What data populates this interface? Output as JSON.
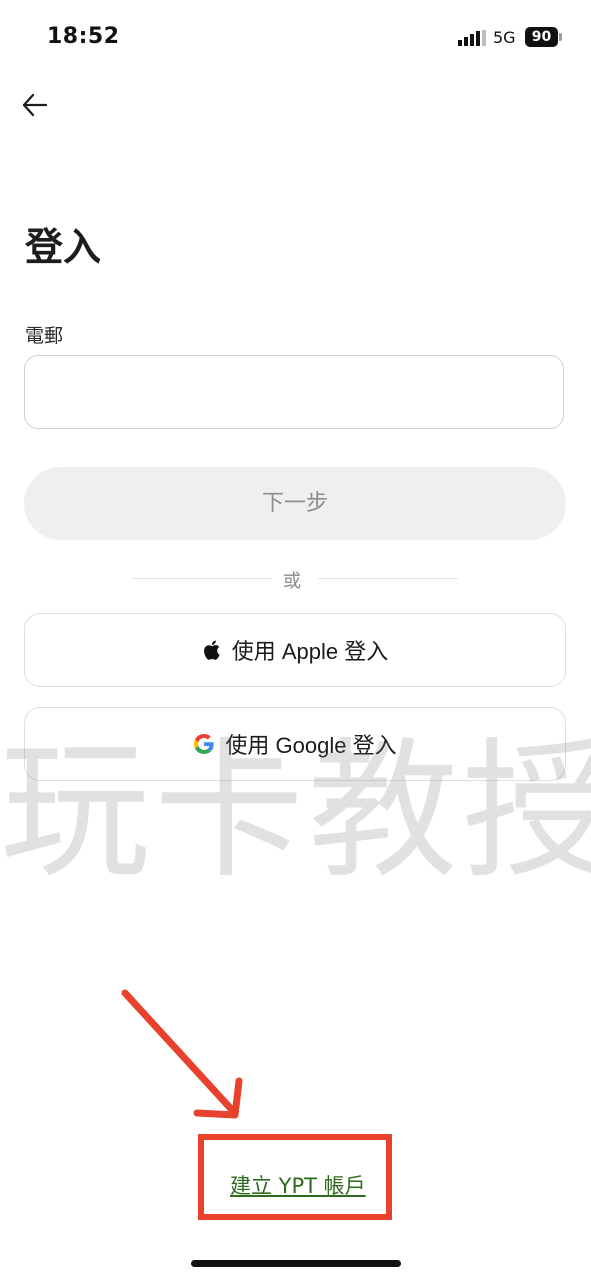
{
  "status_bar": {
    "time": "18:52",
    "network": "5G",
    "battery": "90"
  },
  "header": {
    "title": "登入"
  },
  "form": {
    "email_label": "電郵",
    "email_value": "",
    "email_placeholder": "",
    "next_label": "下一步",
    "divider_text": "或"
  },
  "social": {
    "apple_label": "使用 Apple 登入",
    "google_label": "使用 Google 登入"
  },
  "watermark": "玩卡教授",
  "footer": {
    "create_account_label": "建立 YPT 帳戶"
  },
  "colors": {
    "annotation_red": "#e8412d",
    "link_green": "#2e6b1e",
    "disabled_button_bg": "#efefef"
  }
}
